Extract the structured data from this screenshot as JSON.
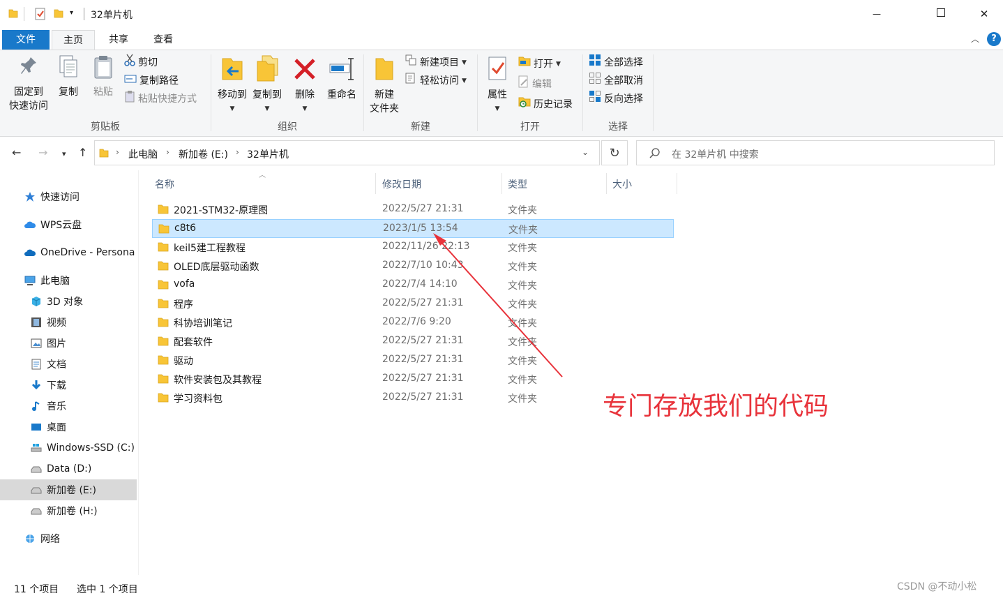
{
  "window": {
    "title": "32单片机",
    "minimize_glyph": "—",
    "maximize_glyph": "☐",
    "close_glyph": "✕"
  },
  "ribbon_tabs": [
    {
      "label": "文件"
    },
    {
      "label": "主页"
    },
    {
      "label": "共享"
    },
    {
      "label": "查看"
    }
  ],
  "ribbon": {
    "clipboard": {
      "pin_label_1": "固定到",
      "pin_label_2": "快速访问",
      "copy_label": "复制",
      "paste_label": "粘贴",
      "cut_label": "剪切",
      "copy_path_label": "复制路径",
      "paste_shortcut_label": "粘贴快捷方式",
      "group_label": "剪贴板"
    },
    "organize": {
      "move_to_label": "移动到",
      "copy_to_label": "复制到",
      "delete_label": "删除",
      "rename_label": "重命名",
      "group_label": "组织"
    },
    "new": {
      "new_folder_label_1": "新建",
      "new_folder_label_2": "文件夹",
      "new_item_label": "新建项目",
      "easy_access_label": "轻松访问",
      "group_label": "新建"
    },
    "open": {
      "properties_label": "属性",
      "open_label": "打开",
      "edit_label": "编辑",
      "history_label": "历史记录",
      "group_label": "打开"
    },
    "select": {
      "select_all_label": "全部选择",
      "select_none_label": "全部取消",
      "invert_label": "反向选择",
      "group_label": "选择"
    }
  },
  "address": {
    "breadcrumb": [
      "此电脑",
      "新加卷 (E:)",
      "32单片机"
    ],
    "search_placeholder": "在 32单片机 中搜索"
  },
  "nav_pane": [
    {
      "label": "快速访问",
      "icon": "star-icon"
    },
    {
      "label": "WPS云盘",
      "icon": "cloud-icon"
    },
    {
      "label": "OneDrive - Persona",
      "icon": "onedrive-icon"
    },
    {
      "label": "此电脑",
      "icon": "computer-icon"
    },
    {
      "label": "3D 对象",
      "icon": "cube-icon"
    },
    {
      "label": "视频",
      "icon": "video-icon"
    },
    {
      "label": "图片",
      "icon": "picture-icon"
    },
    {
      "label": "文档",
      "icon": "document-icon"
    },
    {
      "label": "下载",
      "icon": "download-icon"
    },
    {
      "label": "音乐",
      "icon": "music-icon"
    },
    {
      "label": "桌面",
      "icon": "desktop-icon"
    },
    {
      "label": "Windows-SSD (C:)",
      "icon": "drive-icon"
    },
    {
      "label": "Data (D:)",
      "icon": "drive-icon"
    },
    {
      "label": "新加卷 (E:)",
      "icon": "drive-icon"
    },
    {
      "label": "新加卷 (H:)",
      "icon": "drive-icon"
    },
    {
      "label": "网络",
      "icon": "network-icon"
    }
  ],
  "columns": {
    "name": "名称",
    "date": "修改日期",
    "type": "类型",
    "size": "大小"
  },
  "files": [
    {
      "name": "2021-STM32-原理图",
      "date": "2022/5/27 21:31",
      "type": "文件夹"
    },
    {
      "name": "c8t6",
      "date": "2023/1/5 13:54",
      "type": "文件夹"
    },
    {
      "name": "keil5建工程教程",
      "date": "2022/11/26 22:13",
      "type": "文件夹"
    },
    {
      "name": "OLED底层驱动函数",
      "date": "2022/7/10 10:43",
      "type": "文件夹"
    },
    {
      "name": "vofa",
      "date": "2022/7/4 14:10",
      "type": "文件夹"
    },
    {
      "name": "程序",
      "date": "2022/5/27 21:31",
      "type": "文件夹"
    },
    {
      "name": "科协培训笔记",
      "date": "2022/7/6 9:20",
      "type": "文件夹"
    },
    {
      "name": "配套软件",
      "date": "2022/5/27 21:31",
      "type": "文件夹"
    },
    {
      "name": "驱动",
      "date": "2022/5/27 21:31",
      "type": "文件夹"
    },
    {
      "name": "软件安装包及其教程",
      "date": "2022/5/27 21:31",
      "type": "文件夹"
    },
    {
      "name": "学习资料包",
      "date": "2022/5/27 21:31",
      "type": "文件夹"
    }
  ],
  "status": {
    "count": "11 个项目",
    "selected": "选中 1 个项目"
  },
  "annotation": {
    "text": "专门存放我们的代码",
    "color": "#e8333b"
  },
  "watermark": "CSDN @不动小松",
  "colors": {
    "accent": "#1979ca",
    "selection": "#cce8ff",
    "folder": "#f8c537"
  }
}
